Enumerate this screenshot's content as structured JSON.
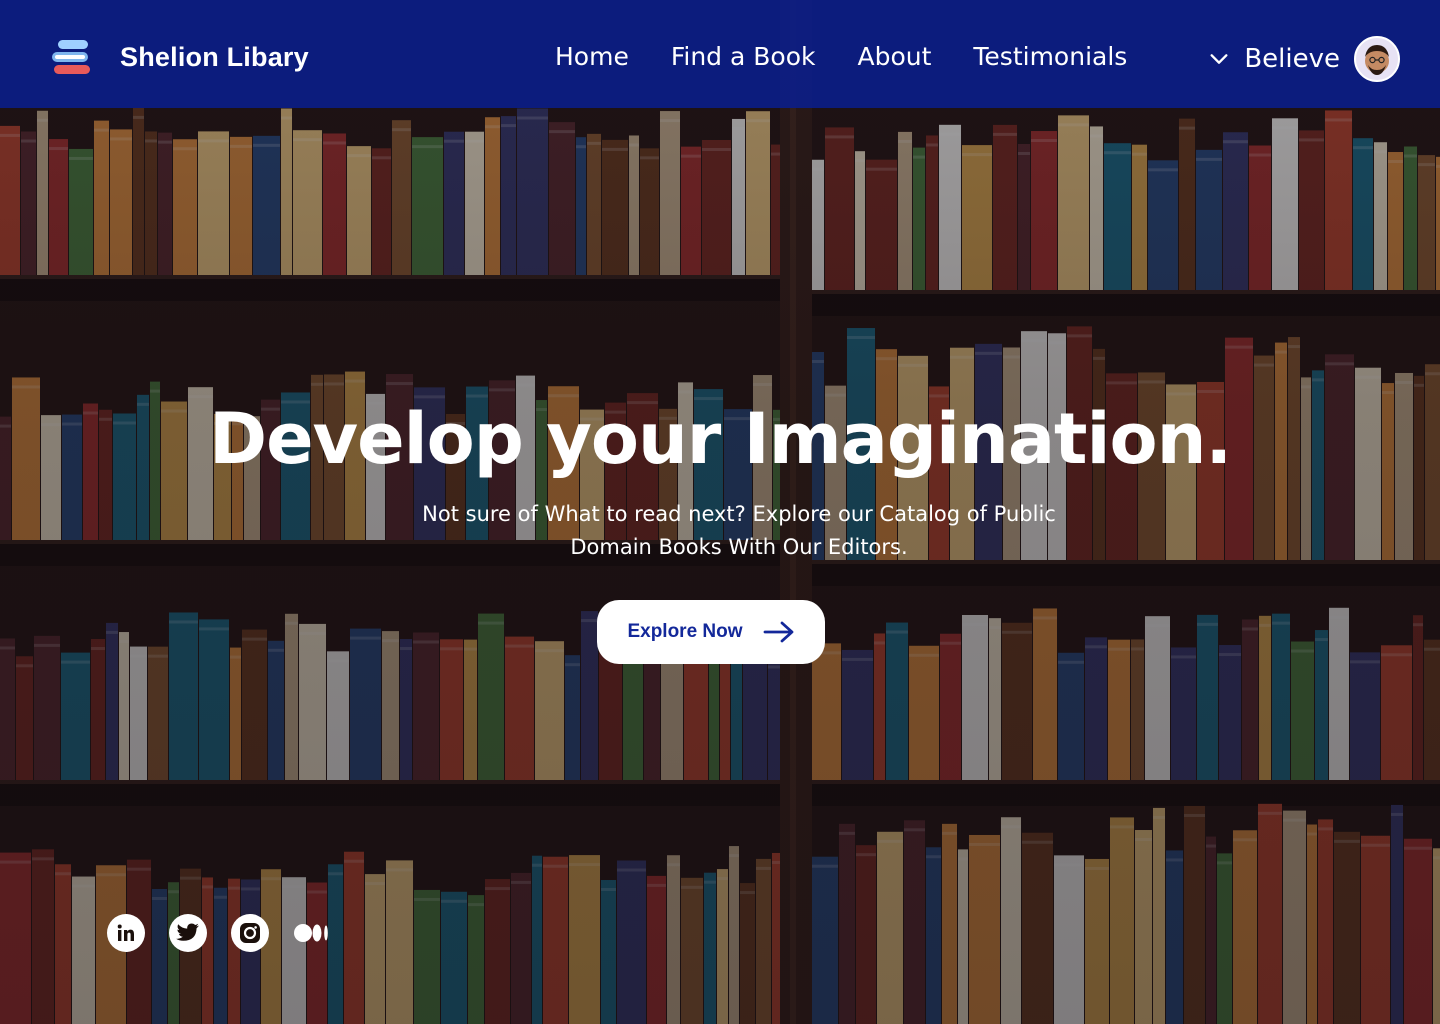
{
  "brand": {
    "name": "Shelion Libary"
  },
  "nav": {
    "items": [
      {
        "label": "Home"
      },
      {
        "label": "Find a Book"
      },
      {
        "label": "About"
      },
      {
        "label": "Testimonials"
      }
    ]
  },
  "user": {
    "name": "Believe",
    "avatar_icon": "avatar-icon"
  },
  "hero": {
    "title": "Develop your Imagination.",
    "subtitle": "Not sure of What to read next? Explore our Catalog of Public Domain Books With Our Editors.",
    "cta_label": "Explore Now"
  },
  "social": [
    {
      "icon": "linkedin-icon"
    },
    {
      "icon": "twitter-icon"
    },
    {
      "icon": "instagram-icon"
    },
    {
      "icon": "medium-icon"
    }
  ],
  "colors": {
    "header_bg": "#0a1e8c",
    "accent": "#13289a",
    "text": "#ffffff"
  }
}
